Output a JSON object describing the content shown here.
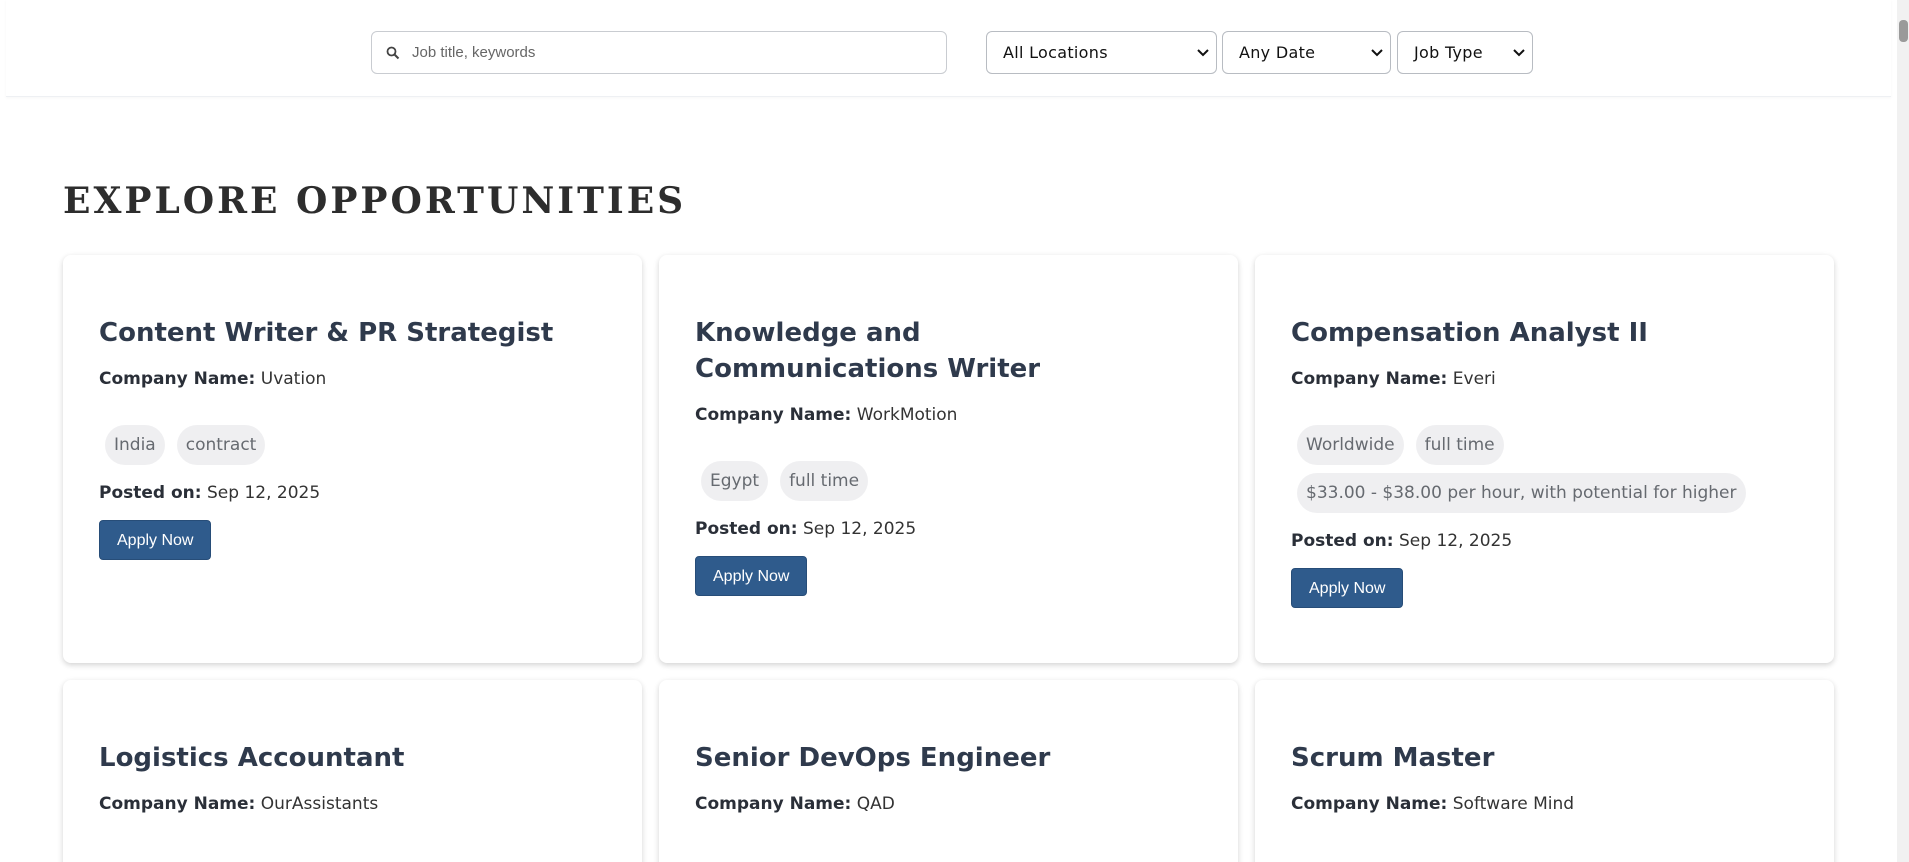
{
  "search": {
    "placeholder": "Job title, keywords"
  },
  "filters": {
    "location": "All Locations",
    "date": "Any Date",
    "type": "Job Type"
  },
  "heading": "EXPLORE OPPORTUNITIES",
  "labels": {
    "company": "Company Name:",
    "posted": "Posted on:",
    "apply": "Apply Now"
  },
  "jobs": [
    {
      "title": "Content Writer & PR Strategist",
      "company": "Uvation",
      "tags": [
        "India",
        "contract"
      ],
      "posted": "Sep 12, 2025"
    },
    {
      "title": "Knowledge and Communications Writer",
      "company": "WorkMotion",
      "tags": [
        "Egypt",
        "full time"
      ],
      "posted": "Sep 12, 2025"
    },
    {
      "title": "Compensation Analyst II",
      "company": "Everi",
      "tags": [
        "Worldwide",
        "full time",
        "$33.00 - $38.00 per hour, with potential for higher"
      ],
      "posted": "Sep 12, 2025"
    },
    {
      "title": "Logistics Accountant",
      "company": "OurAssistants"
    },
    {
      "title": "Senior DevOps Engineer",
      "company": "QAD"
    },
    {
      "title": "Scrum Master",
      "company": "Software Mind"
    }
  ],
  "icons": {
    "search": "search-icon",
    "dropdown": "chevron-down-icon"
  },
  "colors": {
    "button": "#2f5b8c",
    "tag_bg": "#efeff1"
  }
}
